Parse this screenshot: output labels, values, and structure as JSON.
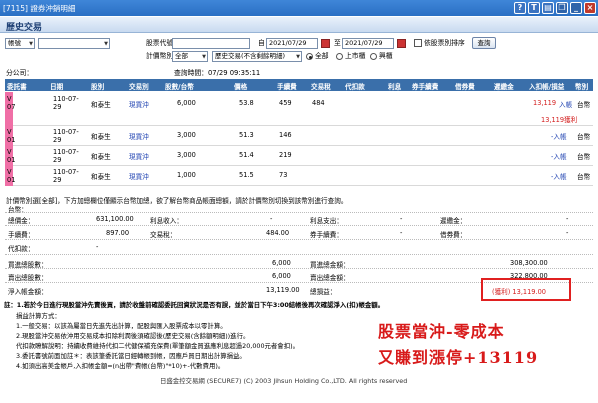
{
  "window": {
    "title": "[7115] 證券沖銷明細"
  },
  "header": {
    "title": "歷史交易"
  },
  "filters": {
    "market": "帳號",
    "account": "",
    "stock_code_label": "股票代號：",
    "stock_code": "",
    "from_label": "自",
    "from_date": "2021/07/29",
    "to_label": "至",
    "to_date": "2021/07/29",
    "sort_label": "依股票別排序",
    "query_button": "查詢",
    "calc_label": "計價幣別：",
    "currency": "全部",
    "trade_type": "歷史交易(不含剩餘明細)",
    "radio_all": "全部",
    "radio_listed": "上市櫃",
    "radio_emerging": "興櫃"
  },
  "meta": {
    "company_label": "分公司：",
    "query_time": "查詢時間：07/29 09:35:11"
  },
  "table": {
    "headers": [
      "委託書",
      "日期",
      "股別",
      "交易別",
      "股數/台幣",
      "價格",
      "手續費",
      "交易稅",
      "代扣款",
      "利息",
      "券手續費",
      "借券費",
      "遲繳金",
      "入扣帳/損益",
      "幣別"
    ],
    "rows": [
      {
        "no": "V\n07",
        "date": "110-07-\n29",
        "name": "和泰生",
        "type": "現買沖",
        "qty": "6,000",
        "price": "53.8",
        "fee": "459",
        "tax": "484",
        "pl": "13,119",
        "pl_mark": "入帳",
        "cur": "台幣",
        "extra": "13,119獲利"
      },
      {
        "no": "V\n01",
        "date": "110-07-\n29",
        "name": "和泰生",
        "type": "現買沖",
        "qty": "3,000",
        "price": "51.3",
        "fee": "146",
        "tax": "",
        "pl": "-入帳",
        "pl_mark": "",
        "cur": "台幣",
        "extra": ""
      },
      {
        "no": "V\n01",
        "date": "110-07-\n29",
        "name": "和泰生",
        "type": "現買沖",
        "qty": "3,000",
        "price": "51.4",
        "fee": "219",
        "tax": "",
        "pl": "-入帳",
        "pl_mark": "",
        "cur": "台幣",
        "extra": ""
      },
      {
        "no": "V\n01",
        "date": "110-07-\n29",
        "name": "和泰生",
        "type": "現買沖",
        "qty": "1,000",
        "price": "51.5",
        "fee": "73",
        "tax": "",
        "pl": "-入帳",
        "pl_mark": "",
        "cur": "台幣",
        "extra": ""
      }
    ]
  },
  "summary": {
    "desc": "計價幣別選[全部]，下方加總欄位僅顯示台幣加總，欲了解台幣商品帳面總額，請於計價幣別切換到該幣別進行查詢。",
    "currency_title": "台幣：",
    "l1": "總價金：",
    "v1": "631,100.00",
    "l2": "利息收入：",
    "v2": "-",
    "l3": "利息支出：",
    "v3": "-",
    "l4": "遲繳金：",
    "v4": "-",
    "l5": "手續費：",
    "v5": "897.00",
    "l6": "交易稅：",
    "v6": "484.00",
    "l7": "券手續費：",
    "v7": "-",
    "l8": "借券費：",
    "v8": "-",
    "l9": "代扣款：",
    "v9": "-",
    "buy_qty_label": "買進總股數：",
    "buy_qty": "6,000",
    "buy_amt_label": "買進總金額：",
    "buy_amt": "308,300.00",
    "sell_qty_label": "賣出總股數：",
    "sell_qty": "6,000",
    "sell_amt_label": "賣出總金額：",
    "sell_amt": "322,800.00",
    "net_label": "淨入帳金額：",
    "net": "13,119.00",
    "pl_label": "總損益：",
    "pl": "(獲利) 13,119.00"
  },
  "notes": {
    "warn": "註：1.若於今日進行現股當沖先賣後買，請於收盤前確認委託回資狀況是否有誤，並於當日下午3:00結帳後再次確認淨入(扣)帳金額。",
    "n0": "損益計算方式：",
    "n1": "1.一般交易：以該為屬當日先進先出計算，配股與匯入股票成本以零計算。",
    "n2": "2.現股當沖交易依沖用交易成本扣除利潤後須確認後(歷史交易(含餘額明細))進行。",
    "n3": "代扣款瞭解說明：持續收費維持代扣二代健保補充保費(單筆額金買進應利息超過20,000元者會扣)。",
    "n4": "3.委託書號前面加註＊：表該筆委託當日經轉帳到帳，因應戶買日期出計算損益。",
    "n5": "4.如須出高美金帳戶,入扣帳金額=(n出帶\"費帳(台幣)\"*10)+-代數費用)。",
    "footer": "日盛金控交易網 (SECURE7) (C) 2003 Jihsun Holding Co.,LTD. All rights reserved"
  },
  "annotation": {
    "line1": "股票當沖-零成本",
    "line2": "又賺到漲停+13119"
  },
  "colors": {
    "accent": "#3a6faa",
    "profit": "#d42020",
    "annotation_box": "#e02020",
    "pink_tab": "#f06fa6"
  }
}
